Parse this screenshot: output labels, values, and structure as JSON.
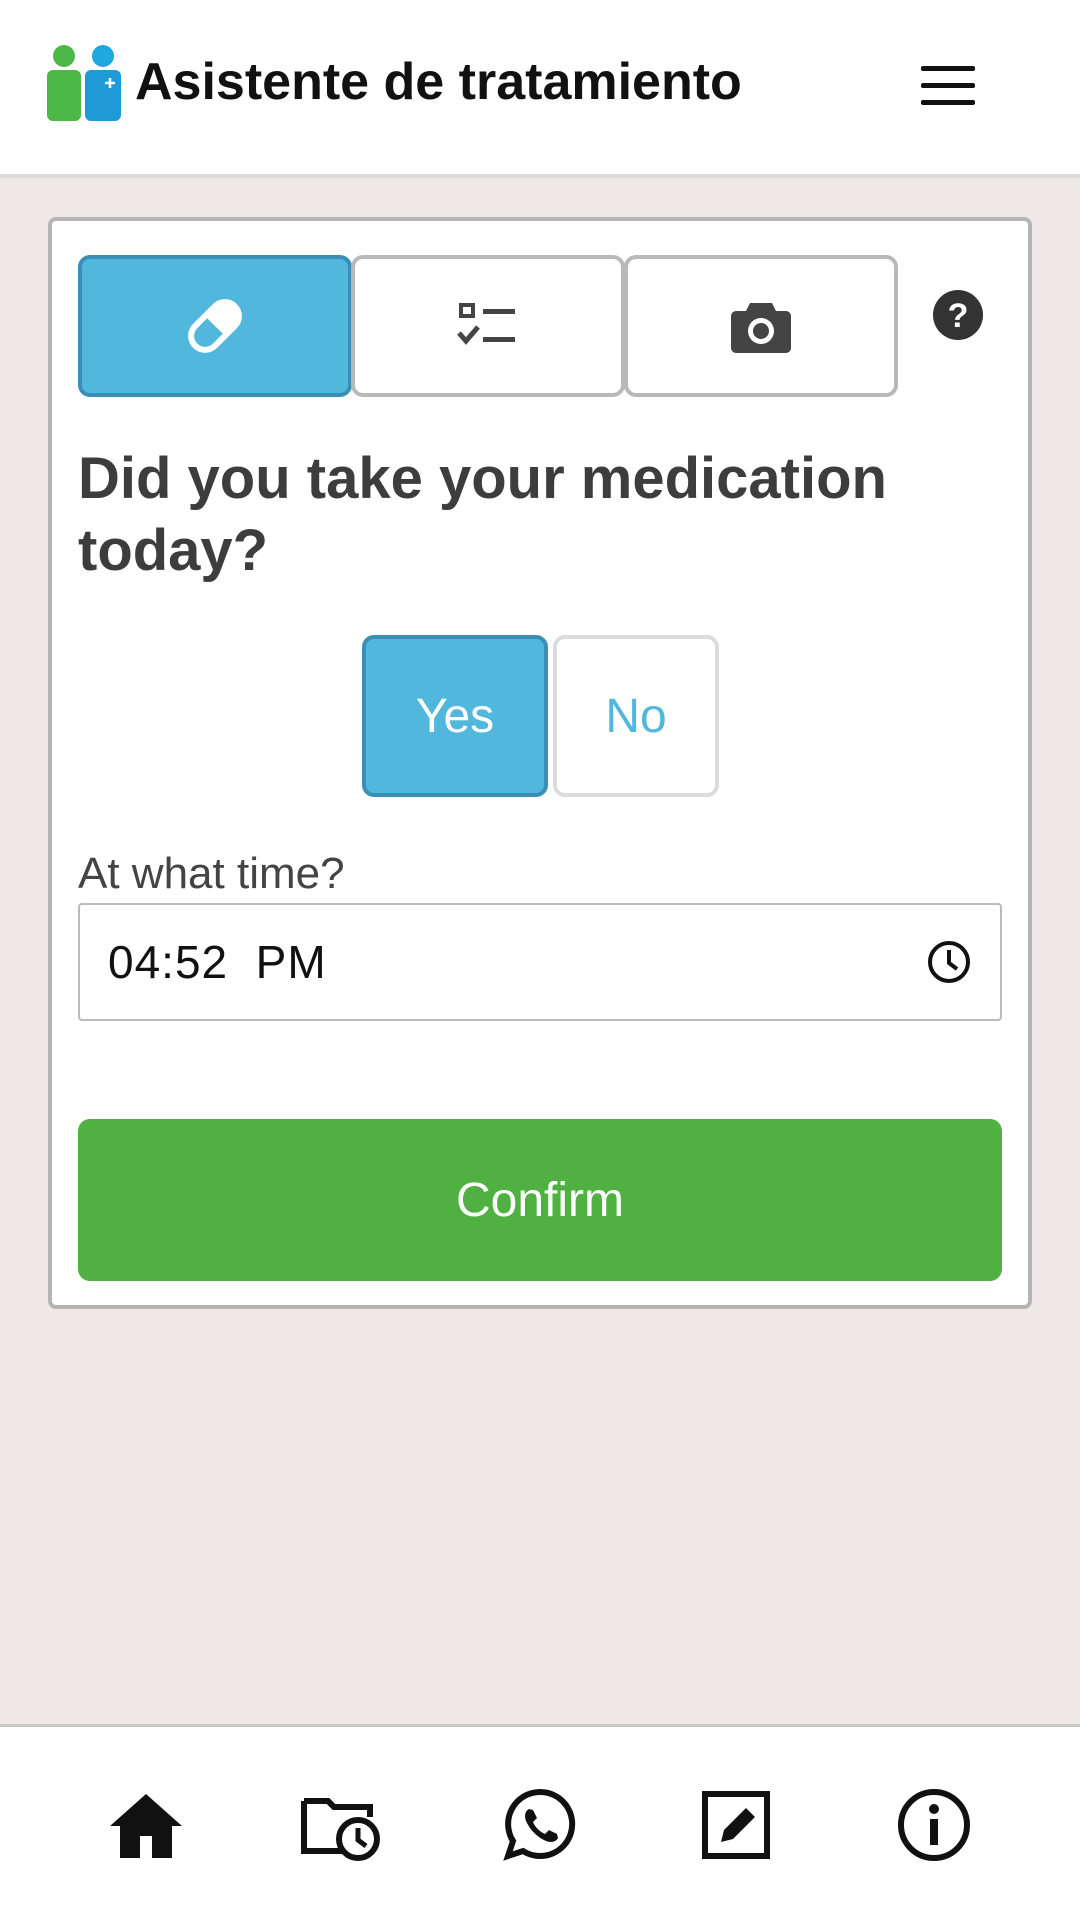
{
  "header": {
    "app_title": "Asistente de tratamiento",
    "logo_icon": "people-medical-logo-icon",
    "menu_icon": "hamburger-menu-icon"
  },
  "tabs": [
    {
      "name": "medication",
      "icon": "pill-icon",
      "active": true
    },
    {
      "name": "checklist",
      "icon": "checklist-icon",
      "active": false
    },
    {
      "name": "photo",
      "icon": "camera-icon",
      "active": false
    }
  ],
  "help_icon": "question-circle-icon",
  "question": "Did you take your medication today?",
  "answer": {
    "yes_label": "Yes",
    "no_label": "No",
    "selected": "Yes"
  },
  "time": {
    "label": "At what time?",
    "value": "04:52  PM"
  },
  "confirm_label": "Confirm",
  "bottom_nav": [
    {
      "name": "home",
      "icon": "home-icon"
    },
    {
      "name": "history",
      "icon": "calendar-clock-icon"
    },
    {
      "name": "whatsapp",
      "icon": "whatsapp-icon"
    },
    {
      "name": "edit",
      "icon": "edit-icon"
    },
    {
      "name": "info",
      "icon": "info-icon"
    }
  ],
  "colors": {
    "accent_blue": "#52b7dd",
    "confirm_green": "#50b142",
    "background": "#eee8e8"
  }
}
